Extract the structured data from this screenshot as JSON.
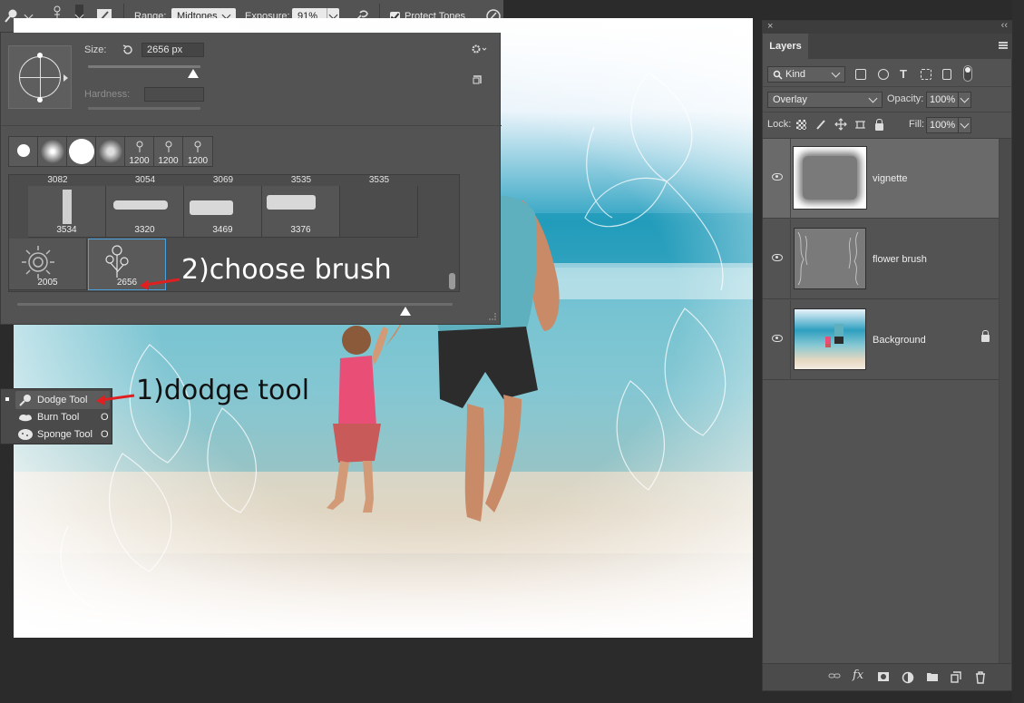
{
  "options_bar": {
    "brush_size": "2656",
    "range_label": "Range:",
    "range_value": "Midtones",
    "exposure_label": "Exposure:",
    "exposure_value": "91%",
    "protect_tones_label": "Protect Tones"
  },
  "brush_picker": {
    "size_label": "Size:",
    "size_value": "2656 px",
    "hardness_label": "Hardness:",
    "preset_strip": [
      "",
      "",
      "",
      "",
      "1200",
      "1200",
      "1200"
    ],
    "grid_headers": [
      "3082",
      "3054",
      "3069",
      "3535",
      "3535"
    ],
    "grid_row1": [
      "3534",
      "3320",
      "3469",
      "3376"
    ],
    "grid_row2": [
      "2005",
      "2656"
    ]
  },
  "annotations": {
    "choose_brush": "2)choose brush",
    "dodge_tool": "1)dodge tool"
  },
  "tool_flyout": {
    "items": [
      {
        "label": "Dodge Tool",
        "key": "O"
      },
      {
        "label": "Burn Tool",
        "key": "O"
      },
      {
        "label": "Sponge Tool",
        "key": "O"
      }
    ]
  },
  "layers_panel": {
    "tab": "Layers",
    "filter_kind": "Kind",
    "blend_mode": "Overlay",
    "opacity_label": "Opacity:",
    "opacity_value": "100%",
    "lock_label": "Lock:",
    "fill_label": "Fill:",
    "fill_value": "100%",
    "layers": [
      {
        "name": "vignette"
      },
      {
        "name": "flower brush"
      },
      {
        "name": "Background"
      }
    ]
  },
  "colors": {
    "selection_blue": "#4aa3df",
    "annotation_arrow": "#e02020",
    "panel_bg": "#535353"
  }
}
